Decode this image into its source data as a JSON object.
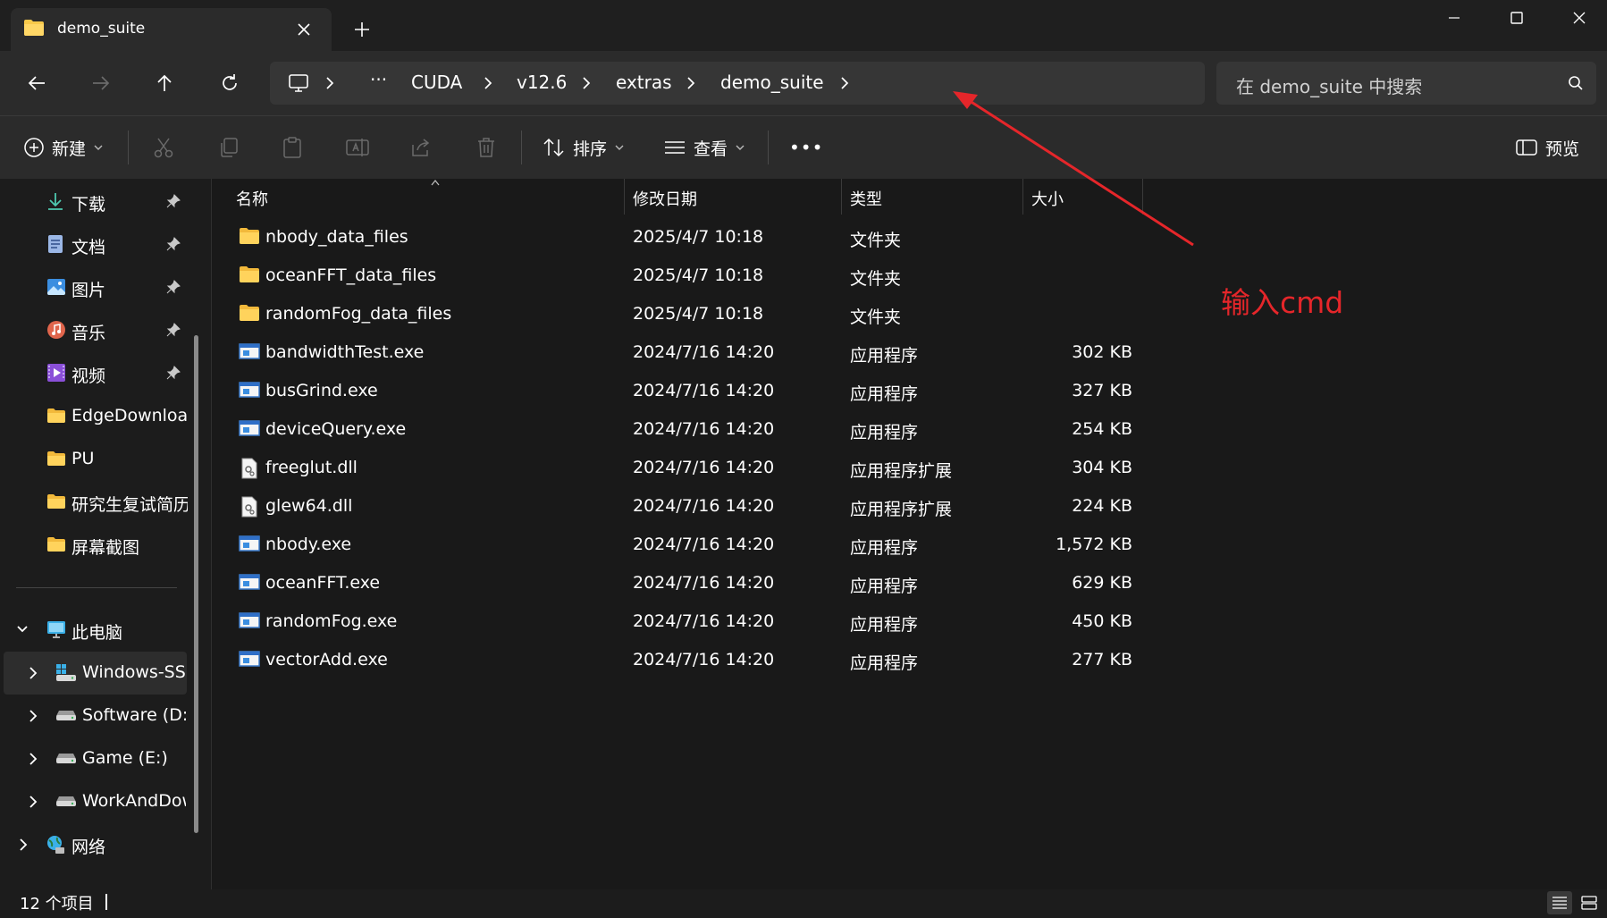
{
  "window": {
    "tab_title": "demo_suite"
  },
  "address": {
    "crumbs": [
      "···",
      "CUDA",
      "v12.6",
      "extras",
      "demo_suite"
    ],
    "search_placeholder": "在 demo_suite 中搜索"
  },
  "toolbar": {
    "new_label": "新建",
    "sort_label": "排序",
    "view_label": "查看",
    "more_label": "•••",
    "preview_label": "预览"
  },
  "sidebar": {
    "quick_access": [
      {
        "label": "下载",
        "icon": "download-icon",
        "pinned": true
      },
      {
        "label": "文档",
        "icon": "document-icon",
        "pinned": true
      },
      {
        "label": "图片",
        "icon": "picture-icon",
        "pinned": true
      },
      {
        "label": "音乐",
        "icon": "music-icon",
        "pinned": true
      },
      {
        "label": "视频",
        "icon": "video-icon",
        "pinned": true
      },
      {
        "label": "EdgeDownload",
        "icon": "folder-icon",
        "pinned": false
      },
      {
        "label": "PU",
        "icon": "folder-icon",
        "pinned": false
      },
      {
        "label": "研究生复试简历",
        "icon": "folder-icon",
        "pinned": false
      },
      {
        "label": "屏幕截图",
        "icon": "folder-icon",
        "pinned": false
      }
    ],
    "this_pc": "此电脑",
    "drives": [
      {
        "label": "Windows-SSD (C:)",
        "icon": "windows-drive-icon"
      },
      {
        "label": "Software (D:)",
        "icon": "drive-icon"
      },
      {
        "label": "Game (E:)",
        "icon": "drive-icon"
      },
      {
        "label": "WorkAndDownload (F:)",
        "icon": "drive-icon"
      }
    ],
    "network": "网络"
  },
  "columns": {
    "name": "名称",
    "modified": "修改日期",
    "type": "类型",
    "size": "大小"
  },
  "files": [
    {
      "name": "nbody_data_files",
      "modified": "2025/4/7 10:18",
      "type": "文件夹",
      "size": "",
      "icon": "folder-icon"
    },
    {
      "name": "oceanFFT_data_files",
      "modified": "2025/4/7 10:18",
      "type": "文件夹",
      "size": "",
      "icon": "folder-icon"
    },
    {
      "name": "randomFog_data_files",
      "modified": "2025/4/7 10:18",
      "type": "文件夹",
      "size": "",
      "icon": "folder-icon"
    },
    {
      "name": "bandwidthTest.exe",
      "modified": "2024/7/16 14:20",
      "type": "应用程序",
      "size": "302 KB",
      "icon": "exe-icon"
    },
    {
      "name": "busGrind.exe",
      "modified": "2024/7/16 14:20",
      "type": "应用程序",
      "size": "327 KB",
      "icon": "exe-icon"
    },
    {
      "name": "deviceQuery.exe",
      "modified": "2024/7/16 14:20",
      "type": "应用程序",
      "size": "254 KB",
      "icon": "exe-icon"
    },
    {
      "name": "freeglut.dll",
      "modified": "2024/7/16 14:20",
      "type": "应用程序扩展",
      "size": "304 KB",
      "icon": "dll-icon"
    },
    {
      "name": "glew64.dll",
      "modified": "2024/7/16 14:20",
      "type": "应用程序扩展",
      "size": "224 KB",
      "icon": "dll-icon"
    },
    {
      "name": "nbody.exe",
      "modified": "2024/7/16 14:20",
      "type": "应用程序",
      "size": "1,572 KB",
      "icon": "exe-icon"
    },
    {
      "name": "oceanFFT.exe",
      "modified": "2024/7/16 14:20",
      "type": "应用程序",
      "size": "629 KB",
      "icon": "exe-icon"
    },
    {
      "name": "randomFog.exe",
      "modified": "2024/7/16 14:20",
      "type": "应用程序",
      "size": "450 KB",
      "icon": "exe-icon"
    },
    {
      "name": "vectorAdd.exe",
      "modified": "2024/7/16 14:20",
      "type": "应用程序",
      "size": "277 KB",
      "icon": "exe-icon"
    }
  ],
  "annotation": {
    "text": "输入cmd",
    "color": "#e5262a"
  },
  "status": {
    "item_count": "12 个项目"
  }
}
